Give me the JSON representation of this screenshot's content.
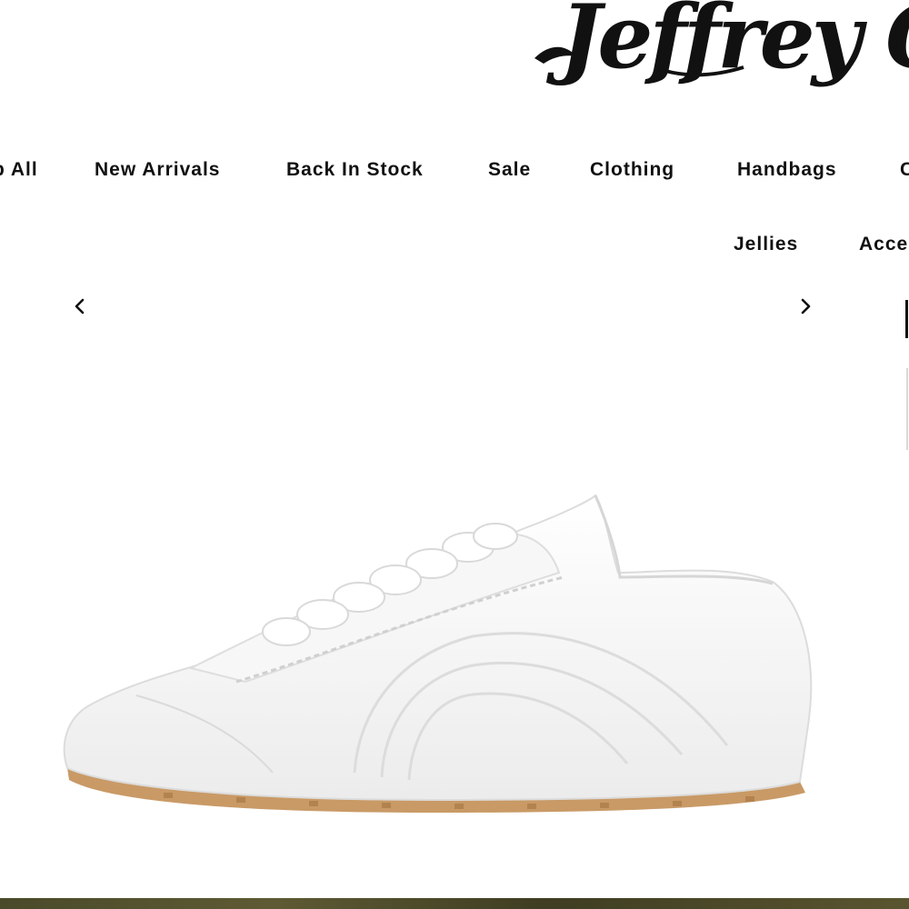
{
  "brand": {
    "logo_text": "Jeffrey C"
  },
  "navigation": {
    "row1": [
      "p All",
      "New Arrivals",
      "Back In Stock",
      "Sale",
      "Clothing",
      "Handbags",
      "C"
    ],
    "row2": [
      "Jellies",
      "Acce"
    ]
  },
  "carousel": {
    "prev_icon": "chevron-left-icon",
    "next_icon": "chevron-right-icon"
  },
  "product": {
    "image_subject": "white leather sneaker with gum sole",
    "colors": {
      "upper": "#f4f4f4",
      "sole": "#c99a66"
    }
  }
}
